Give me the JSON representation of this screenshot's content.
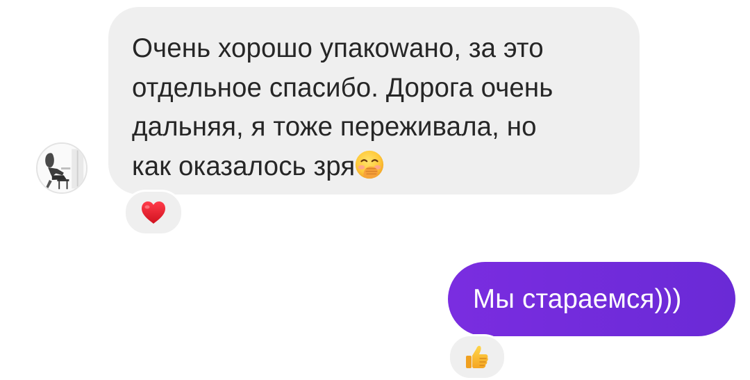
{
  "conversation": {
    "incoming": {
      "text": "Очень хорошо упакowано, за это\nотдельное спасибо. Дорога очень\nдальняя, я тоже переживала, но\nкак оказалось зря",
      "inline_emoji": "hand-over-mouth-emoji",
      "reaction": "heart-emoji",
      "bubble_color": "#efefef"
    },
    "outgoing": {
      "text": "Мы стараемся)))",
      "reaction": "thumbs-up-emoji",
      "bubble_color": "#7028dc"
    }
  }
}
